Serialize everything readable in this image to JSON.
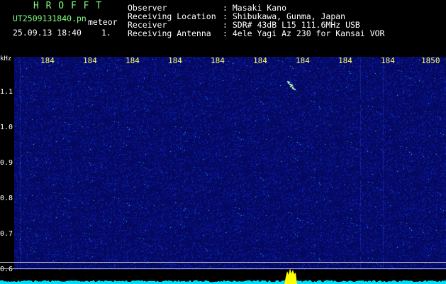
{
  "header": {
    "logo": "H R O F F T",
    "filename": "UT2509131840.pn",
    "meteor_label": "meteor",
    "datetime": "25.09.13 18:40",
    "page_index": "1.",
    "info": [
      {
        "key": "Observer",
        "value": ": Masaki Kano"
      },
      {
        "key": "Receiving Location",
        "value": ": Shibukawa, Gunma, Japan"
      },
      {
        "key": "Receiver",
        "value": ": SDR# 43dB L15 111.6MHz USB"
      },
      {
        "key": "Receiving Antenna",
        "value": ": 4ele Yagi Az 230 for Kansai VOR"
      }
    ]
  },
  "y_axis": {
    "unit": "kHz",
    "ticks": [
      "1.1",
      "1.0",
      "0.9",
      "0.8",
      "0.7",
      "0.6"
    ]
  },
  "x_axis": {
    "ticks": [
      "184",
      "184",
      "184",
      "184",
      "184",
      "184",
      "184",
      "184",
      "184",
      "1850"
    ]
  },
  "colors": {
    "background": "#000000",
    "spectrogram": "#05085c",
    "ticks": "#ffff66",
    "logo": "#7fff7f",
    "trace": "#00e5ff",
    "meteor": "#ffff00"
  }
}
